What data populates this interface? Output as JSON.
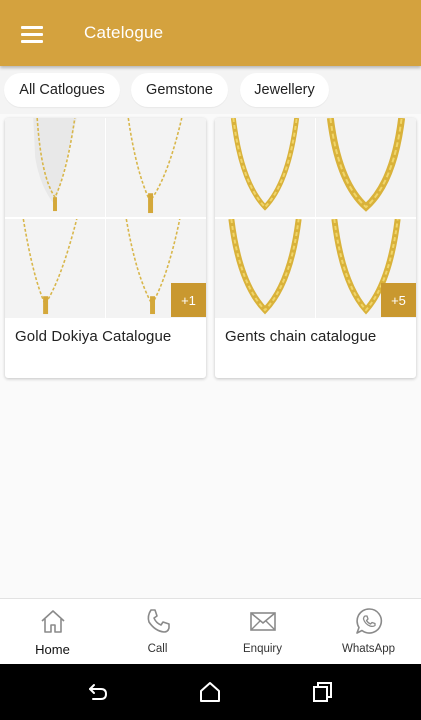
{
  "appbar": {
    "title": "Catelogue",
    "menu_icon": "hamburger-menu-icon"
  },
  "chips": [
    {
      "label": "All Catlogues"
    },
    {
      "label": "Gemstone"
    },
    {
      "label": "Jewellery"
    }
  ],
  "catalogues": [
    {
      "title": "Gold Dokiya Catalogue",
      "more": "+1",
      "image_type": "necklace-photo"
    },
    {
      "title": "Gents chain catalogue",
      "more": "+5",
      "image_type": "chain-photo"
    }
  ],
  "bottom_nav": [
    {
      "label": "Home",
      "icon": "home-icon"
    },
    {
      "label": "Call",
      "icon": "phone-icon"
    },
    {
      "label": "Enquiry",
      "icon": "mail-icon"
    },
    {
      "label": "WhatsApp",
      "icon": "whatsapp-icon"
    }
  ],
  "system_nav": {
    "back_icon": "back-icon",
    "home_icon": "home-circle-icon",
    "recents_icon": "recents-icon"
  },
  "colors": {
    "accent": "#d4a23e",
    "badge": "#c9982f"
  }
}
